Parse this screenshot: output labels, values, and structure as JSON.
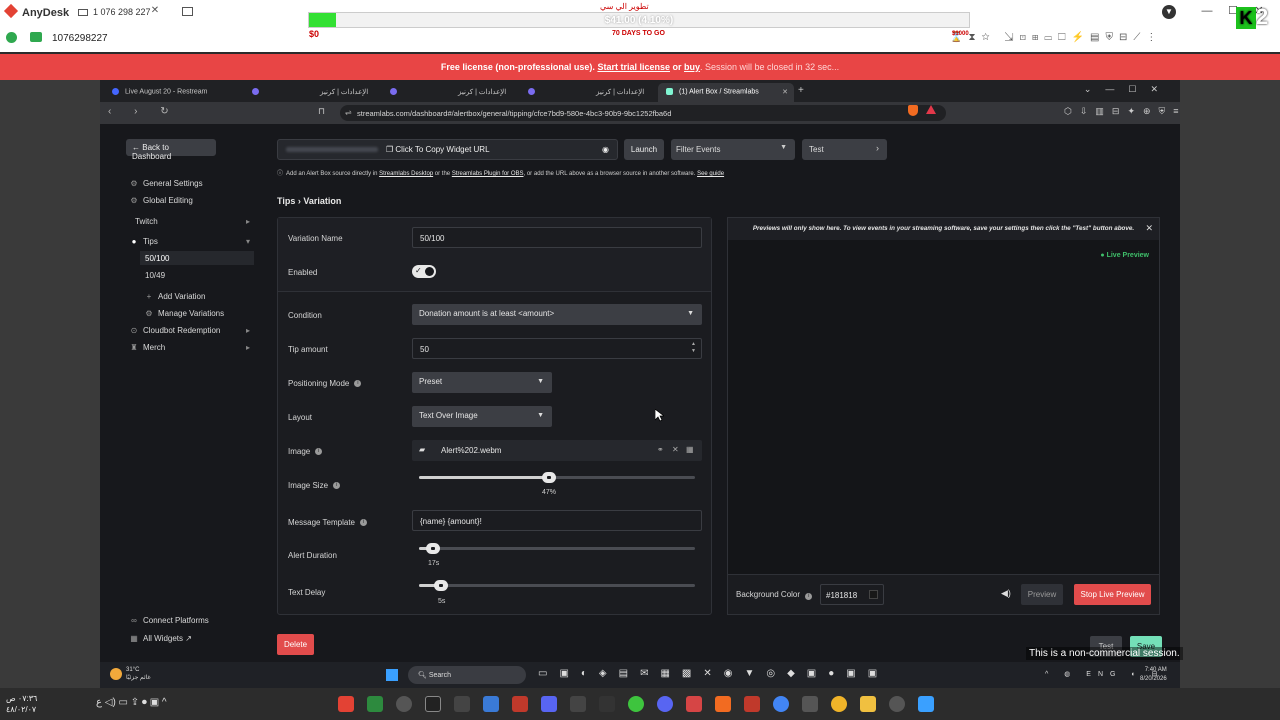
{
  "anydesk": {
    "app_name": "AnyDesk",
    "session_address": "1 076 298 227",
    "remote_id": "1076298227",
    "window_controls": [
      "—",
      "☐",
      "✕"
    ]
  },
  "goal_overlay": {
    "title": "تطوير الي سي",
    "amount_text": "$41.00 (4.10%)",
    "start_label": "$0",
    "days_label": "70 DAYS TO GO",
    "end_label": "$1000",
    "progress_percent": 4.1,
    "badge_number": "2"
  },
  "license_banner": {
    "prefix": "Free license (non-professional use).",
    "trial_link": "Start trial license",
    "or_text": "or",
    "buy_link": "buy",
    "suffix": ". Session will be closed in 32 sec..."
  },
  "browser": {
    "tabs": [
      {
        "label": "Live August 20 - Restream",
        "active": false
      },
      {
        "label": "",
        "active": false
      },
      {
        "label": "الإعدادات | كرنيز",
        "active": false
      },
      {
        "label": "",
        "active": false
      },
      {
        "label": "الإعدادات | كرنيز",
        "active": false
      },
      {
        "label": "",
        "active": false
      },
      {
        "label": "الإعدادات | كرنيز",
        "active": false
      },
      {
        "label": "(1) Alert Box / Streamlabs",
        "active": true
      }
    ],
    "url": "streamlabs.com/dashboard#/alertbox/general/tipping/cfce7bd9-580e-4bc3-90b9-9bc1252fba6d"
  },
  "sidebar": {
    "back_label": "Back to Dashboard",
    "items": [
      {
        "label": "General Settings",
        "icon": "gear-icon"
      },
      {
        "label": "Global Editing",
        "icon": "gear-icon"
      },
      {
        "label": "Twitch",
        "icon": ""
      },
      {
        "label": "Tips",
        "icon": "tips-icon"
      },
      {
        "label": "50/100",
        "icon": ""
      },
      {
        "label": "10/49",
        "icon": ""
      },
      {
        "label": "Add Variation",
        "icon": "plus-icon"
      },
      {
        "label": "Manage Variations",
        "icon": "gear-icon"
      },
      {
        "label": "Cloudbot Redemption",
        "icon": "cloudbot-icon"
      },
      {
        "label": "Merch",
        "icon": "merch-icon"
      }
    ],
    "connect_platforms": "Connect Platforms",
    "all_widgets": "All Widgets"
  },
  "widget_bar": {
    "copy_label": "Click To Copy Widget URL",
    "launch_label": "Launch",
    "filter_label": "Filter Events",
    "test_label": "Test",
    "info": {
      "prefix": "Add an Alert Box source directly in",
      "link1": "Streamlabs Desktop",
      "mid": "or the",
      "link2": "Streamlabs Plugin for OBS",
      "suffix": ", or add the URL above as a browser source in another software.",
      "link3": "See guide"
    }
  },
  "breadcrumb": "Tips › Variation",
  "form": {
    "variation_name": {
      "label": "Variation Name",
      "value": "50/100"
    },
    "enabled": {
      "label": "Enabled",
      "value": true
    },
    "condition": {
      "label": "Condition",
      "value": "Donation amount is at least <amount>"
    },
    "tip_amount": {
      "label": "Tip amount",
      "value": "50"
    },
    "positioning_mode": {
      "label": "Positioning Mode",
      "value": "Preset"
    },
    "layout": {
      "label": "Layout",
      "value": "Text Over Image"
    },
    "image": {
      "label": "Image",
      "value": "Alert%202.webm"
    },
    "image_size": {
      "label": "Image Size",
      "value_text": "47%",
      "value": 47
    },
    "message_template": {
      "label": "Message Template",
      "value": "{name}  {amount}!"
    },
    "alert_duration": {
      "label": "Alert Duration",
      "value_text": "17s",
      "fraction": 0.05
    },
    "text_delay": {
      "label": "Text Delay",
      "value_text": "5s",
      "fraction": 0.08
    }
  },
  "preview": {
    "note": "Previews will only show here. To view events in your streaming software, save your settings then click the \"Test\" button above.",
    "live_label": "● Live Preview",
    "bg_label": "Background Color",
    "bg_value": "#181818",
    "preview_button": "Preview",
    "stop_button": "Stop Live Preview"
  },
  "footer": {
    "delete_label": "Delete",
    "test_label": "Test",
    "save_label": "Save",
    "noncommercial": "This is a non-commercial session."
  },
  "remote_taskbar": {
    "weather_temp": "31°C",
    "weather_text": "غائم جزئيًا",
    "search_label": "Search",
    "lang": "ENG",
    "time": "7:40 AM",
    "date": "8/20/2026"
  },
  "local_taskbar": {
    "time": "٠٧:٣٦ ص",
    "date": "٤٨/٠٢/٠٧"
  },
  "colors": {
    "accent_red": "#e24c4c",
    "save_green": "#74e0b8",
    "live_green": "#3fbf6a",
    "license_red": "#e84545"
  }
}
